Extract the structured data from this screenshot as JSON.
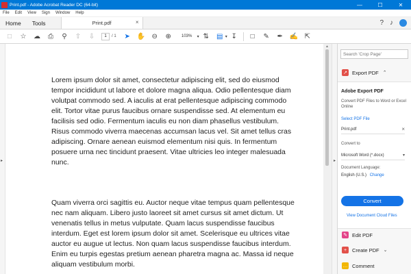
{
  "window": {
    "title": "Print.pdf - Adobe Acrobat Reader DC (64-bit)",
    "minimize": "—",
    "restore": "☐",
    "close": "✕"
  },
  "menu": [
    "File",
    "Edit",
    "View",
    "Sign",
    "Window",
    "Help"
  ],
  "tabs": {
    "home": "Home",
    "tools": "Tools",
    "document": "Print.pdf",
    "close": "×"
  },
  "toolbar": {
    "page_current": "1",
    "page_total": "/ 1",
    "zoom": "103%"
  },
  "document": {
    "paragraphs": [
      "Lorem ipsum dolor sit amet, consectetur adipiscing elit, sed do eiusmod tempor incididunt ut labore et dolore magna aliqua. Odio pellentesque diam volutpat commodo sed. A iaculis at erat pellentesque adipiscing commodo elit. Tortor vitae purus faucibus ornare suspendisse sed. At elementum eu facilisis sed odio. Fermentum iaculis eu non diam phasellus vestibulum. Risus commodo viverra maecenas accumsan lacus vel. Sit amet tellus cras adipiscing. Ornare aenean euismod elementum nisi quis. In fermentum posuere urna nec tincidunt praesent. Vitae ultricies leo integer malesuada nunc.",
      "Quam viverra orci sagittis eu. Auctor neque vitae tempus quam pellentesque nec nam aliquam. Libero justo laoreet sit amet cursus sit amet dictum. Ut venenatis tellus in metus vulputate. Quam lacus suspendisse faucibus interdum. Eget est lorem ipsum dolor sit amet. Scelerisque eu ultrices vitae auctor eu augue ut lectus. Non quam lacus suspendisse faucibus interdum. Enim eu turpis egestas pretium aenean pharetra magna ac. Massa id neque aliquam vestibulum morbi."
    ]
  },
  "right_pane": {
    "search_placeholder": "Search 'Crop Page'",
    "export_pdf": "Export PDF",
    "export_panel": {
      "title": "Adobe Export PDF",
      "description": "Convert PDF Files to Word or Excel Online",
      "select_pdf": "Select PDF File",
      "file_name": "Print.pdf",
      "convert_to_label": "Convert to",
      "format": "Microsoft Word (*.docx)",
      "language_label": "Document Language:",
      "language": "English (U.S.)",
      "change": "Change",
      "convert_button": "Convert",
      "cloud_link": "View Document Cloud Files"
    },
    "edit_pdf": "Edit PDF",
    "create_pdf": "Create PDF",
    "comment": "Comment"
  },
  "colors": {
    "titlebar": "#0078d7",
    "accent": "#1473e6",
    "export_icon": "#e2514a",
    "edit_icon": "#e34489",
    "create_icon": "#e2514a",
    "comment_icon": "#f2b705"
  }
}
